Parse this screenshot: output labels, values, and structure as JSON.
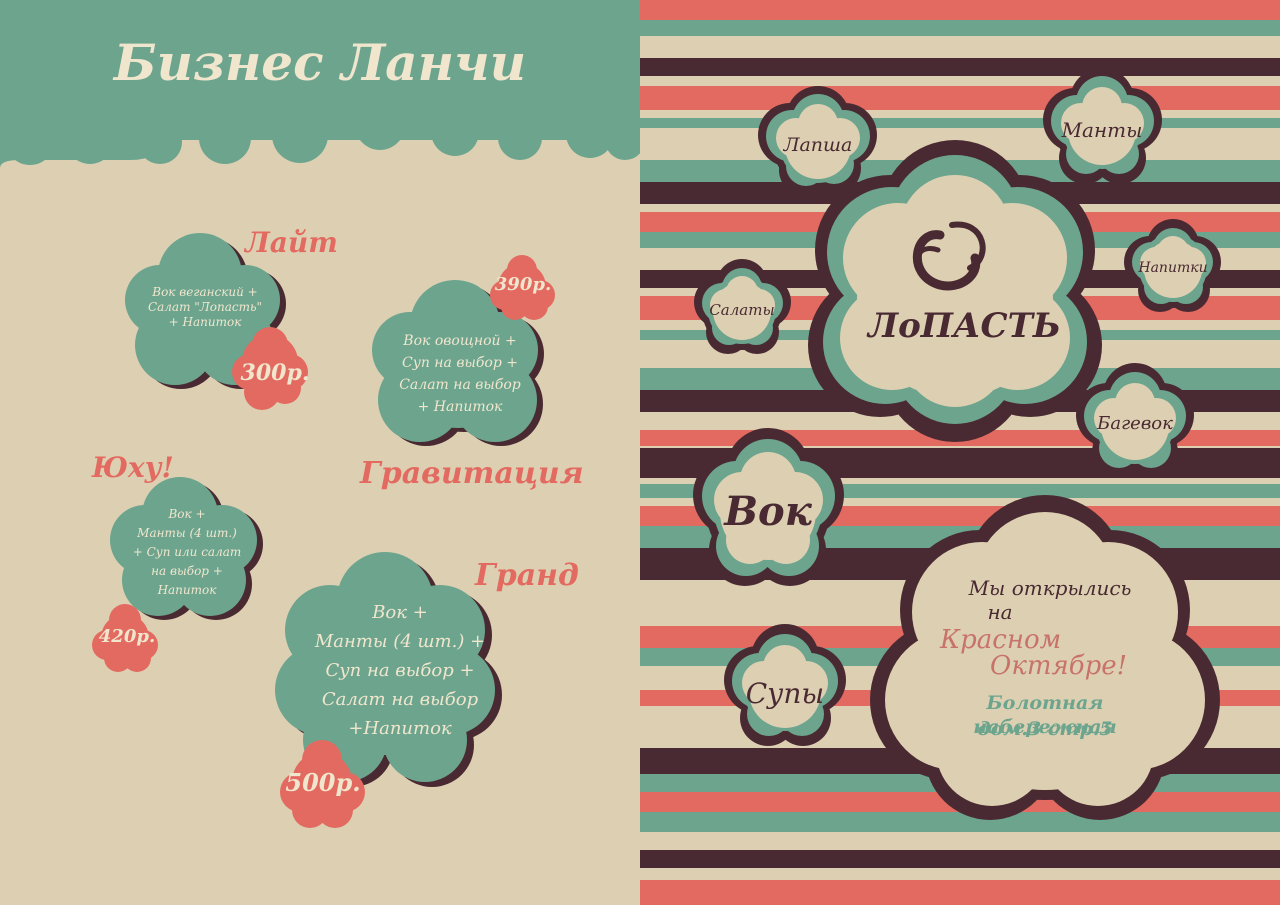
{
  "colors": {
    "cream": "#ddd0b2",
    "teal": "#6ca48e",
    "red": "#e36a60",
    "dark": "#4a2a32"
  },
  "left_page": {
    "title": "Бизнес Ланчи",
    "combos": [
      {
        "name": "Лайт",
        "items": "Вок веганский +\nСалат \"Лопасть\"\n+ Напиток",
        "price": "300р."
      },
      {
        "name": "Гравитация",
        "items": "Вок овощной +\nСуп на выбор +\nСалат на выбор\n+ Напиток",
        "price": "390р."
      },
      {
        "name": "Юху!",
        "items": "Вок +\nМанты (4 шт.)\n+ Суп или салат\nна выбор +\nНапиток",
        "price": "420р."
      },
      {
        "name": "Гранд",
        "items": "Вок +\nМанты (4 шт.) +\nСуп на выбор +\nСалат на выбор\n+Напиток",
        "price": "500р."
      }
    ]
  },
  "right_page": {
    "logo_text": "ЛоПАСТЬ",
    "categories": [
      "Лапша",
      "Манты",
      "Напитки",
      "Салаты",
      "Багевок",
      "Вок",
      "Супы"
    ],
    "announcement": {
      "line1": "Мы открылись",
      "line2": "на",
      "highlight1": "Красном",
      "highlight2": "Октябре!",
      "address1": "Болотная набережная",
      "address2": "дом.3 стр.5"
    }
  }
}
